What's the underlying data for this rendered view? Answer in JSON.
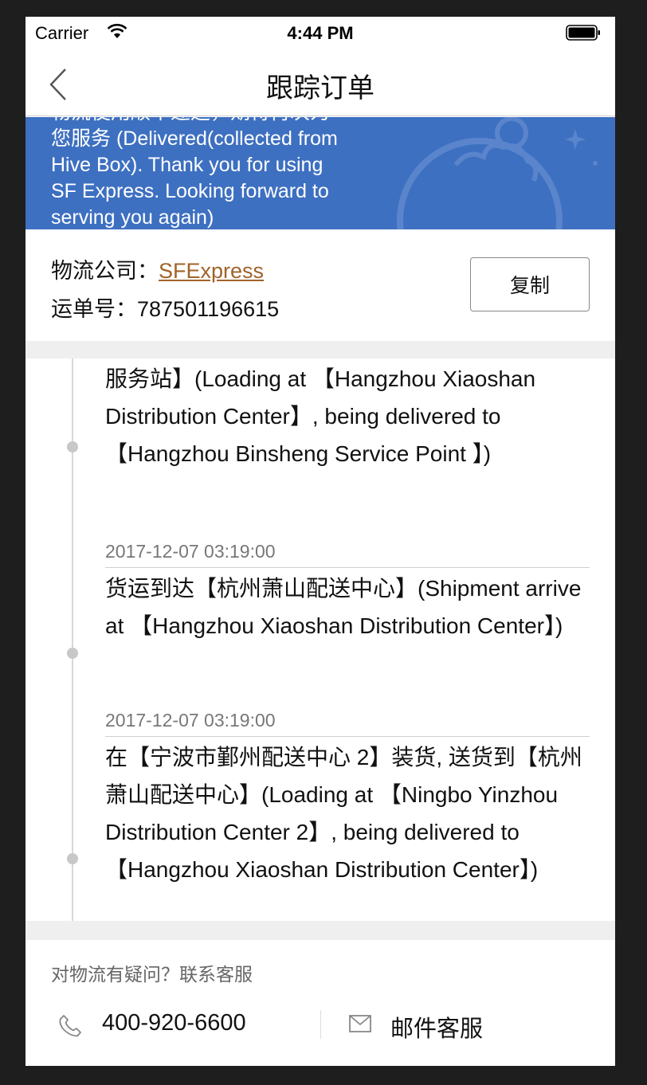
{
  "status_bar": {
    "carrier": "Carrier",
    "time": "4:44 PM"
  },
  "nav": {
    "title": "跟踪订单"
  },
  "banner": {
    "text": "物流使用顺丰速运，期待再次为您服务 (Delivered(collected from Hive Box). Thank you for using SF Express. Looking forward to serving you again)"
  },
  "company": {
    "company_label": "物流公司：",
    "company_name": "SFExpress",
    "tracking_label": "运单号：",
    "tracking_number": "787501196615",
    "copy_label": "复制"
  },
  "timeline": {
    "entries": [
      {
        "date": "",
        "desc": "在【杭州萧山配送中心】装货, 送货到【杭州滨盛服务站】(Loading at 【Hangzhou Xiaoshan Distribution Center】, being delivered to 【Hangzhou Binsheng Service Point 】)"
      },
      {
        "date": "2017-12-07 03:19:00",
        "desc": "货运到达【杭州萧山配送中心】(Shipment arrive at 【Hangzhou Xiaoshan Distribution Center】)"
      },
      {
        "date": "2017-12-07 03:19:00",
        "desc": "在【宁波市鄞州配送中心 2】装货, 送货到【杭州萧山配送中心】(Loading at 【Ningbo Yinzhou Distribution Center 2】, being delivered to 【Hangzhou Xiaoshan Distribution Center】)"
      }
    ]
  },
  "footer": {
    "question": "对物流有疑问？联系客服",
    "phone_number": "400-920-6600",
    "mail_label": "邮件客服"
  }
}
